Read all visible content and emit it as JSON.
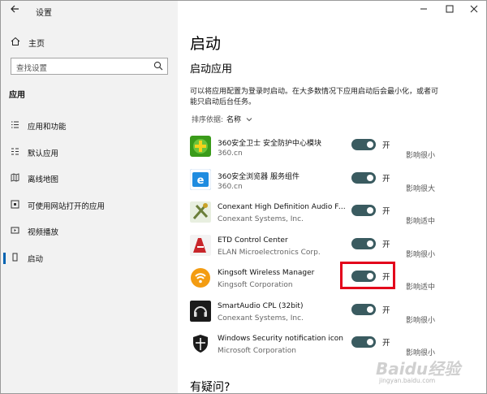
{
  "window": {
    "title": "设置"
  },
  "nav": {
    "home_label": "主页",
    "search_placeholder": "查找设置",
    "section_label": "应用",
    "items": [
      {
        "label": "应用和功能",
        "icon": "apps-list-icon"
      },
      {
        "label": "默认应用",
        "icon": "default-apps-icon"
      },
      {
        "label": "离线地图",
        "icon": "offline-map-icon"
      },
      {
        "label": "可使用网站打开的应用",
        "icon": "web-app-icon"
      },
      {
        "label": "视频播放",
        "icon": "video-icon"
      },
      {
        "label": "启动",
        "icon": "startup-icon",
        "active": true
      }
    ]
  },
  "main": {
    "title": "启动",
    "subtitle": "启动应用",
    "description": "可以将应用配置为登录时启动。在大多数情况下应用启动后会最小化，或者可能只启动后台任务。",
    "sort_label": "排序依据:",
    "sort_value": "名称",
    "apps": [
      {
        "name": "360安全卫士 安全防护中心模块",
        "publisher": "360.cn",
        "state": "开",
        "on": true,
        "impact": "影响很小",
        "icon": "360-safe-icon"
      },
      {
        "name": "360安全浏览器 服务组件",
        "publisher": "360.cn",
        "state": "开",
        "on": true,
        "impact": "影响很大",
        "icon": "360-browser-icon"
      },
      {
        "name": "Conexant High Definition Audio Filt...",
        "publisher": "Conexant Systems, Inc.",
        "state": "开",
        "on": true,
        "impact": "影响适中",
        "icon": "conexant-audio-icon"
      },
      {
        "name": "ETD Control Center",
        "publisher": "ELAN Microelectronics Corp.",
        "state": "开",
        "on": true,
        "impact": "影响很小",
        "icon": "etd-control-icon"
      },
      {
        "name": "Kingsoft Wireless Manager",
        "publisher": "Kingsoft Corporation",
        "state": "开",
        "on": true,
        "impact": "影响适中",
        "icon": "kingsoft-wifi-icon"
      },
      {
        "name": "SmartAudio CPL (32bit)",
        "publisher": "Conexant Systems, Inc.",
        "state": "开",
        "on": true,
        "impact": "影响很小",
        "icon": "smartaudio-icon"
      },
      {
        "name": "Windows Security notification icon",
        "publisher": "Microsoft Corporation",
        "state": "开",
        "on": true,
        "impact": "影响很小",
        "icon": "windows-security-icon"
      }
    ],
    "faq_title": "有疑问?"
  },
  "watermark": {
    "text": "Baidu经验",
    "url_text": "jingyan.baidu.com"
  },
  "colors": {
    "toggle_on": "#3a5b60",
    "highlight": "#e3001b",
    "accent": "#0063b1",
    "sidebar_bg": "#f2f2f2"
  }
}
